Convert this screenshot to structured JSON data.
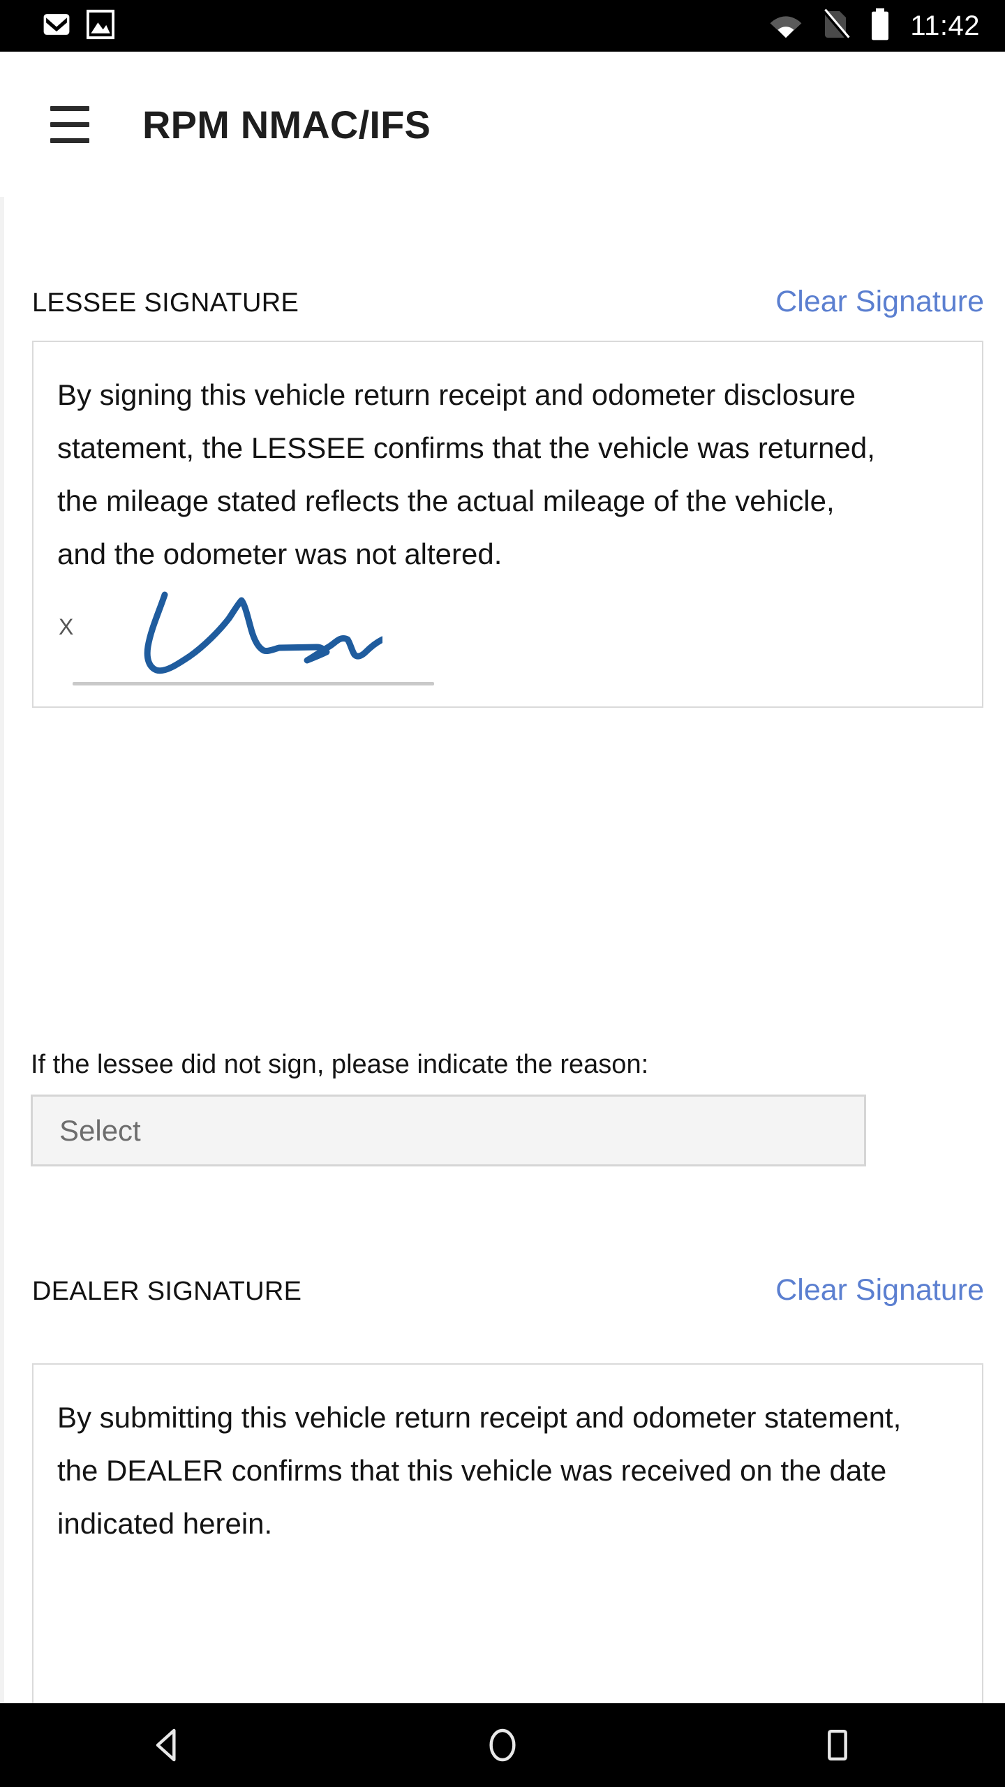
{
  "status_bar": {
    "time": "11:42",
    "icons": [
      "gmail-icon",
      "photos-icon",
      "wifi-icon",
      "no-sim-icon",
      "battery-full-icon"
    ]
  },
  "app_bar": {
    "menu_icon": "hamburger-menu-icon",
    "title": "RPM NMAC/IFS"
  },
  "colors": {
    "link_blue": "#5b7fd0",
    "signature_ink": "#1f5c9e",
    "field_background": "#f4f4f4",
    "field_border": "#d5d5d5",
    "box_border": "#dadada",
    "status_bar": "#000000"
  },
  "lessee_section": {
    "title": "LESSEE SIGNATURE",
    "clear_label": "Clear Signature",
    "consent_text": "By signing this vehicle return receipt and odometer disclosure statement, the LESSEE confirms that the vehicle was returned, the mileage stated reflects the actual mileage of the vehicle, and the odometer was not altered.",
    "signature_marker": "X",
    "signature_present": true
  },
  "reason_field": {
    "label": "If the lessee did not sign, please indicate the reason:",
    "placeholder": "Select",
    "value": ""
  },
  "dealer_section": {
    "title": "DEALER SIGNATURE",
    "clear_label": "Clear Signature",
    "consent_text": "By submitting this vehicle return receipt and odometer statement, the DEALER confirms that this vehicle was received on the date indicated herein."
  },
  "nav_bar": {
    "back": "back-triangle-icon",
    "home": "home-circle-icon",
    "recents": "recents-square-icon"
  }
}
